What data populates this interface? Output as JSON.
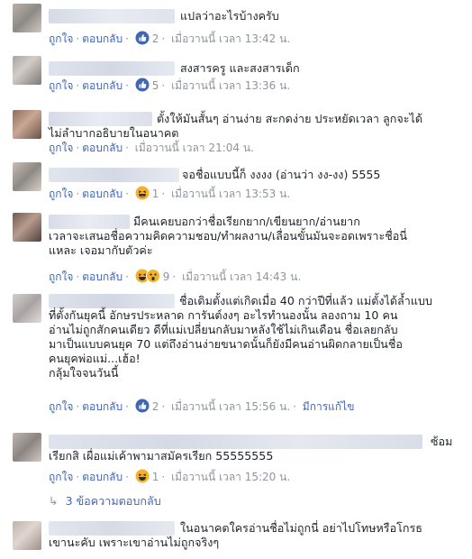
{
  "action_labels": {
    "like": "ถูกใจ",
    "reply": "ตอบกลับ"
  },
  "colors": {
    "link": "#4267b2",
    "meta": "#90949c",
    "like_blue": "#4267b2",
    "haha_yellow": "#f7b125"
  },
  "comments": [
    {
      "lines": [
        "แปลว่าอะไรบ้างครับ"
      ],
      "reactions": [
        "like-icon"
      ],
      "count": "2",
      "time": "เมื่อวานนี้ เวลา 13:42 น.",
      "extra": ""
    },
    {
      "lines": [
        "สงสารครู และสงสารเด็ก"
      ],
      "reactions": [
        "like-icon"
      ],
      "count": "5",
      "time": "เมื่อวานนี้ เวลา 13:36 น.",
      "extra": ""
    },
    {
      "lines": [
        "ตั้งให้มันสั้นๆ อ่านง่าย สะกดง่าย ประหยัดเวลา ลูกจะได้",
        "ไม่ลำบากอธิบายในอนาคต"
      ],
      "reactions": [],
      "count": "",
      "time": "เมื่อวานนี้ เวลา 21:04 น.",
      "extra": ""
    },
    {
      "lines": [
        "จอชื่อแบบนี้ก็ งงงง (อ่านว่า งง-งง) 5555"
      ],
      "reactions": [
        "haha-icon"
      ],
      "count": "1",
      "time": "เมื่อวานนี้ เวลา 13:53 น.",
      "extra": ""
    },
    {
      "lines": [
        "มีคนเคยบอกว่าชื่อเรียกยาก/เขียนยาก/อ่านยาก",
        "เวลาจะเสนอชื่อความคิดความชอบ/ทำผลงาน/เลื่อนขั้นมันจะอดเพราะชื่อนี่",
        "แหละ เจอมากับตัวค่ะ"
      ],
      "reactions": [
        "haha-icon",
        "wow-icon"
      ],
      "count": "9",
      "time": "เมื่อวานนี้ เวลา 14:43 น.",
      "extra": ""
    },
    {
      "lines": [
        "ชื่อเดิมตั้งแต่เกิดเมื่อ 40 กว่าปีที่แล้ว แม่ตั้งได้ล้ำแบบ",
        "ที่ตั้งกันยุคนี้ อักษรประหลาด การันต์งงๆ อะไรทำนองนั้น ลองถาม 10 คน",
        "อ่านไม่ถูกสักคนเดียว ดีที่แม่เปลี่ยนกลับมาหลังใช้ไม่เกินเดือน ชื่อเลยกลับ",
        "มาเป็นแบบคนยุค 70 แต่ถึงอ่านง่ายขนาดนั้นก็ยังมีคนอ่านผิดกลายเป็นชื่อ",
        "คนยุคพ่อแม่...เฮ้อ!",
        "กลุ้มใจจนวันนี้"
      ],
      "reactions": [
        "like-icon"
      ],
      "count": "2",
      "time": "เมื่อวานนี้ เวลา 15:56 น.",
      "extra": "มีการแก้ไข"
    },
    {
      "lines": [
        "ซ้อม",
        "เรียกสิ เผื่อแม่เค้าพามาสมัครเรียก 55555555"
      ],
      "reactions": [
        "haha-icon"
      ],
      "count": "1",
      "time": "เมื่อวานนี้ เวลา 15:20 น.",
      "extra": ""
    },
    {
      "lines": [
        "ในอนาคตใครอ่านชื่อไม่ถูกนี่ อย่าไปโทษหรือโกรธ",
        "เขานะคับ เพราะเขาอ่านไม่ถูกจริงๆ"
      ],
      "reactions": [],
      "count": "",
      "time": "",
      "extra": ""
    }
  ],
  "replies_link": {
    "icon": "reply-arrow-icon",
    "label": "3 ข้อความตอบกลับ"
  }
}
